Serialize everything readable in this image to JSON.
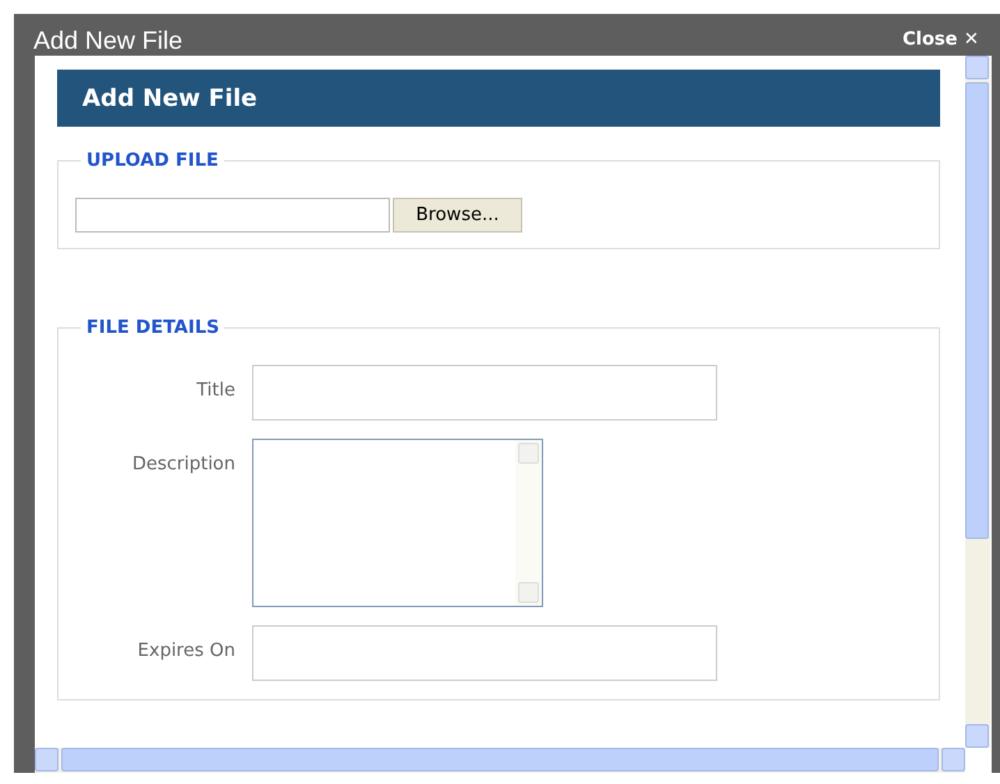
{
  "window": {
    "title": "Add New File",
    "close": "Close",
    "close_icon": "✕"
  },
  "dialog": {
    "header": "Add New File"
  },
  "upload": {
    "legend": "UPLOAD FILE",
    "browse": "Browse..."
  },
  "details": {
    "legend": "FILE DETAILS",
    "fields": [
      {
        "label": "Title",
        "kind": "text"
      },
      {
        "label": "Description",
        "kind": "textarea"
      },
      {
        "label": "Expires On",
        "kind": "text"
      }
    ]
  }
}
